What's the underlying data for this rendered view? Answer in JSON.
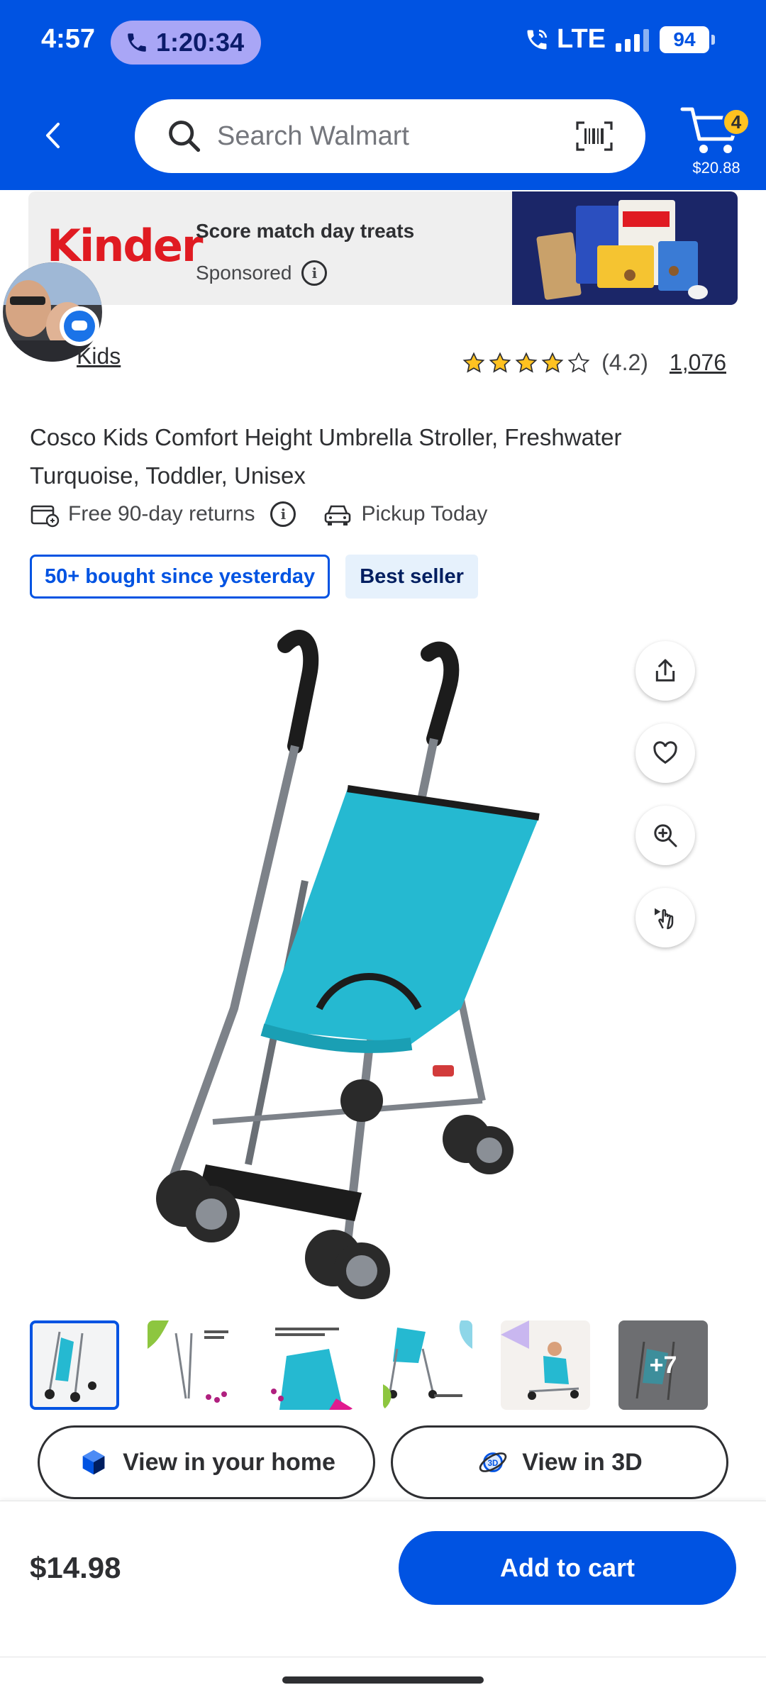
{
  "status_bar": {
    "time": "4:57",
    "call_timer": "1:20:34",
    "network": "LTE",
    "battery": "94"
  },
  "header": {
    "search_placeholder": "Search Walmart",
    "cart_count": "4",
    "cart_total": "$20.88"
  },
  "ad": {
    "brand_logo": "Kinder",
    "headline": "Score match day treats",
    "sponsored_label": "Sponsored"
  },
  "product": {
    "brand": "Kids",
    "rating_stars": 4.2,
    "rating": "(4.2)",
    "review_count": "1,076",
    "title": "Cosco Kids Comfort Height Umbrella Stroller, Freshwater Turquoise, Toddler, Unisex",
    "returns_label": "Free 90-day returns",
    "pickup_label": "Pickup Today",
    "badge_bought": "50+ bought since yesterday",
    "badge_bestseller": "Best seller",
    "more_images_label": "+7"
  },
  "actions": {
    "view_home": "View in your home",
    "view_3d": "View in 3D",
    "price": "$14.98",
    "add_to_cart": "Add to cart"
  },
  "colors": {
    "brand_blue": "#0053e2",
    "spark_yellow": "#ffc220",
    "stroller_teal": "#25b9d1"
  }
}
